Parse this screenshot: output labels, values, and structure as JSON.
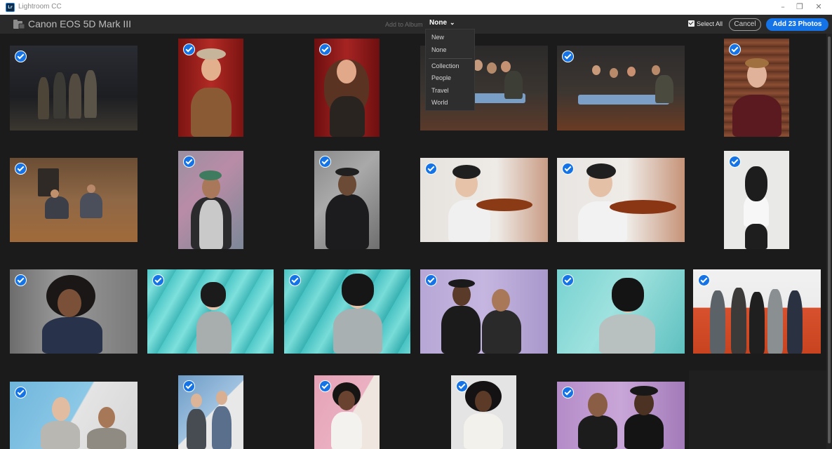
{
  "window": {
    "app_icon": "Lr",
    "title": "Lightroom CC",
    "minimize": "–",
    "restore": "❐",
    "close": "✕"
  },
  "header": {
    "device_name": "Canon EOS 5D Mark III",
    "add_to_album_label": "Add to Album",
    "album_value": "None",
    "select_all_label": "Select All",
    "cancel_label": "Cancel",
    "add_button_label": "Add 23 Photos"
  },
  "dropdown": {
    "items": [
      "New",
      "None",
      "Collection",
      "People",
      "Travel",
      "World"
    ]
  },
  "photos": {
    "count_shown": 23,
    "all_selected": true
  },
  "colors": {
    "accent": "#1473e6",
    "background": "#1b1b1b",
    "header": "#2a2a2a"
  }
}
